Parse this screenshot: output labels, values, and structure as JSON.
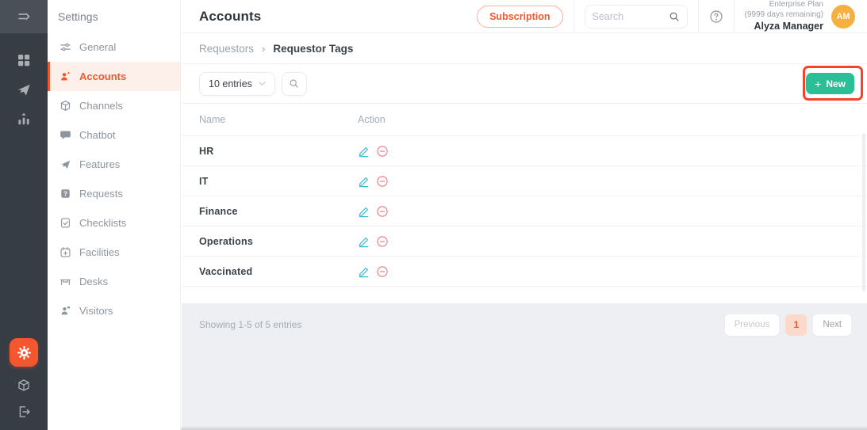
{
  "colors": {
    "brand_orange": "#f4572e",
    "accent_green": "#2bbf97",
    "annotation_red": "#f5432b",
    "edit_blue": "#45b7d8",
    "delete_red": "#f0808a",
    "avatar_amber": "#f6b041",
    "rail_dark": "#373d45",
    "footer_gray": "#edeff2"
  },
  "rail": {
    "top_icon": "collapse-sidebar",
    "icons": [
      "dashboard",
      "announcements",
      "analytics"
    ],
    "bottom_icons": [
      "settings-gear",
      "integrations-cube",
      "logout-door"
    ]
  },
  "settings_nav": {
    "title": "Settings",
    "items": [
      {
        "label": "General",
        "icon": "sliders",
        "active": false
      },
      {
        "label": "Accounts",
        "icon": "users",
        "active": true
      },
      {
        "label": "Channels",
        "icon": "cube",
        "active": false
      },
      {
        "label": "Chatbot",
        "icon": "chat",
        "active": false
      },
      {
        "label": "Features",
        "icon": "megaphone",
        "active": false
      },
      {
        "label": "Requests",
        "icon": "question",
        "active": false
      },
      {
        "label": "Checklists",
        "icon": "checklist",
        "active": false
      },
      {
        "label": "Facilities",
        "icon": "calendar",
        "active": false
      },
      {
        "label": "Desks",
        "icon": "desk",
        "active": false
      },
      {
        "label": "Visitors",
        "icon": "visitor",
        "active": false
      }
    ]
  },
  "header": {
    "title": "Accounts",
    "subscription_label": "Subscription",
    "search_placeholder": "Search",
    "plan_line1": "Enterprise Plan",
    "plan_line2": "(9999 days remaining)",
    "user_name": "Alyza Manager",
    "avatar_initials": "AM"
  },
  "breadcrumb": {
    "parent": "Requestors",
    "separator": "›",
    "current": "Requestor Tags"
  },
  "toolbar": {
    "entries_select_value": "10 entries",
    "new_button_plus": "+",
    "new_button_label": "New"
  },
  "table": {
    "columns": [
      "Name",
      "Action"
    ],
    "row_actions": [
      "edit",
      "remove"
    ],
    "rows": [
      {
        "name": "HR"
      },
      {
        "name": "IT"
      },
      {
        "name": "Finance"
      },
      {
        "name": "Operations"
      },
      {
        "name": "Vaccinated"
      }
    ]
  },
  "footer": {
    "showing_text": "Showing 1-5 of 5 entries",
    "pagination": {
      "previous": "Previous",
      "current_page": "1",
      "next": "Next"
    }
  }
}
